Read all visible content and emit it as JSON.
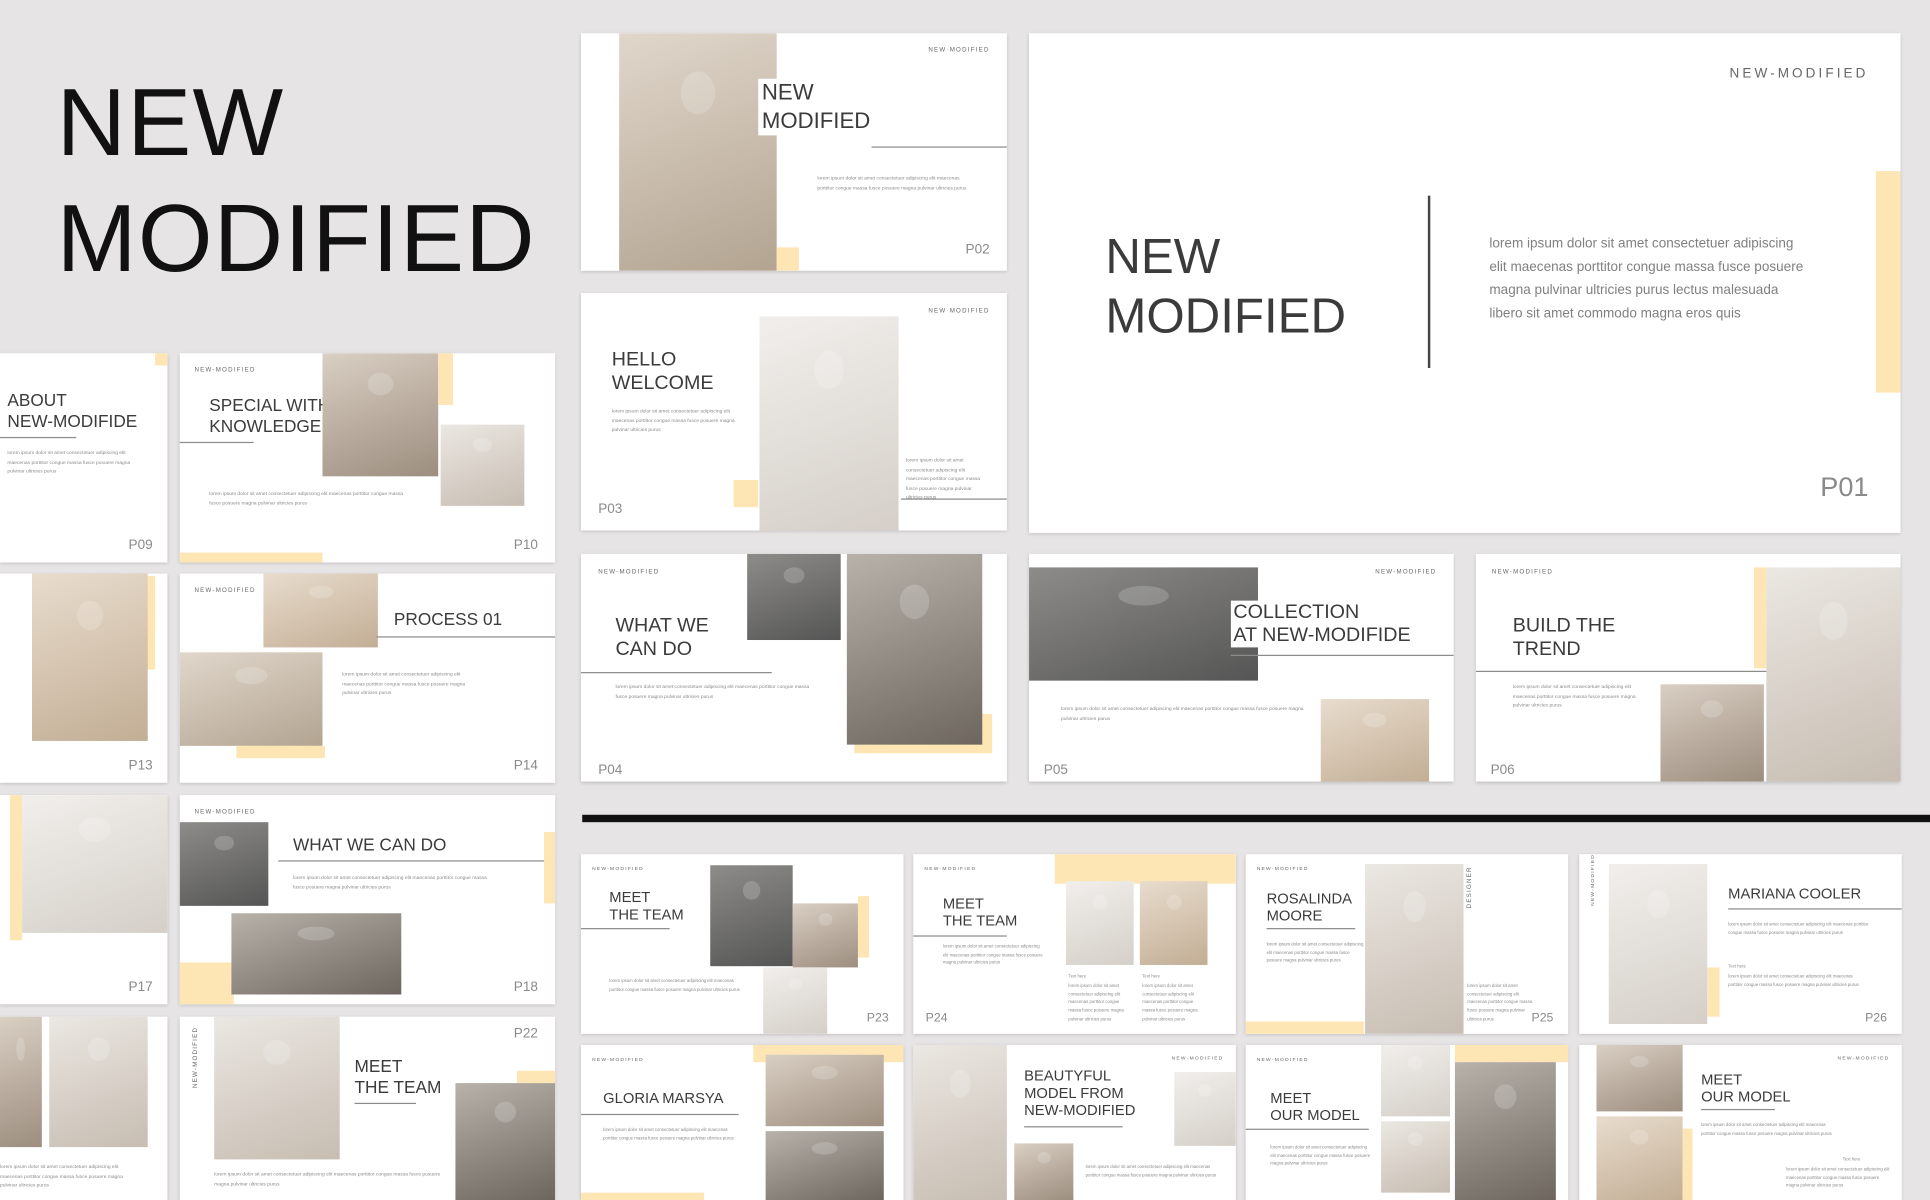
{
  "hero": {
    "line1": "NEW",
    "line2": "MODIFIED"
  },
  "brand": "NEW-MODIFIED",
  "brand_dots": "NEW·MODIFIED",
  "designer_tag": "DESIGNER",
  "body_short": "lorem ipsum dolor sit amet consectetuer adipiscing elit maecenas porttitor congue massa fusce posuere magna pulvinar ultricies purus",
  "body_long": "lorem ipsum dolor sit amet consectetuer adipiscing elit maecenas porttitor congue massa fusce posuere magna pulvinar ultricies purus lectus malesuada libero sit amet commodo magna eros quis",
  "text_here": "Text here",
  "colors": {
    "accent": "#fde5b4",
    "background": "#e6e4e4",
    "divider": "#111111"
  },
  "slides": {
    "p01": {
      "l1": "NEW",
      "l2": "MODIFIED",
      "body": "lorem ipsum dolor sit amet consectetuer adipiscing elit maecenas porttitor congue massa fusce posuere magna pulvinar ultricies purus lectus malesuada libero sit amet commodo magna eros quis",
      "page": "P01"
    },
    "p02": {
      "l1": "NEW",
      "l2": "MODIFIED",
      "page": "P02"
    },
    "p03": {
      "l1": "HELLO",
      "l2": "WELCOME",
      "page": "P03"
    },
    "p04": {
      "l1": "WHAT WE",
      "l2": "CAN DO",
      "page": "P04"
    },
    "p05": {
      "l1": "COLLECTION",
      "l2": "AT NEW-MODIFIDE",
      "page": "P05"
    },
    "p06": {
      "l1": "BUILD THE",
      "l2": "TREND",
      "page": "P06"
    },
    "p09": {
      "l1": "ABOUT",
      "l2": "NEW-MODIFIDE",
      "page": "P09"
    },
    "p10": {
      "l1": "SPECIAL WITH",
      "l2": "KNOWLEDGE",
      "page": "P10"
    },
    "p13": {
      "page": "P13"
    },
    "p14": {
      "l1": "PROCESS 01",
      "page": "P14"
    },
    "p17": {
      "page": "P17"
    },
    "p18": {
      "l1": "WHAT WE CAN DO",
      "page": "P18"
    },
    "p22": {
      "l1": "MEET",
      "l2": "THE TEAM",
      "page": "P22"
    },
    "p23": {
      "l1": "MEET",
      "l2": "THE TEAM",
      "page": "P23"
    },
    "p24": {
      "l1": "MEET",
      "l2": "THE TEAM",
      "page": "P24"
    },
    "p25": {
      "l1": "ROSALINDA",
      "l2": "MOORE",
      "page": "P25"
    },
    "p26": {
      "l1": "MARIANA COOLER",
      "page": "P26"
    },
    "p27": {
      "l1": "GLORIA MARSYA"
    },
    "p28": {
      "l1": "BEAUTYFUL",
      "l2": "MODEL FROM",
      "l3": "NEW-MODIFIED"
    },
    "p29": {
      "l1": "MEET",
      "l2": "OUR MODEL"
    },
    "p30": {
      "l1": "MEET",
      "l2": "OUR MODEL"
    }
  }
}
